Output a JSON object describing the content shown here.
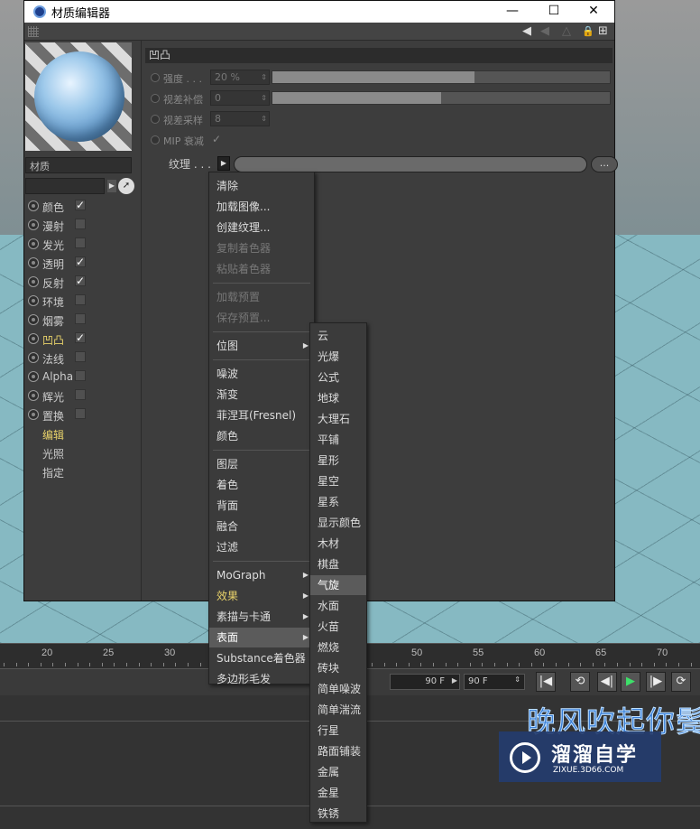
{
  "window": {
    "title": "材质编辑器",
    "buttons": {
      "minimize": "—",
      "maximize": "☐",
      "close": "✕"
    }
  },
  "toolbar": {
    "icons": [
      "grip-icon",
      "arrow-back-icon",
      "triangle-icon",
      "lock-icon",
      "add-panel-icon"
    ],
    "lock_glyph": "🔒",
    "add_glyph": "⊞"
  },
  "left": {
    "material_name": "材质",
    "channels": [
      {
        "label": "颜色",
        "checked": true
      },
      {
        "label": "漫射",
        "checked": false
      },
      {
        "label": "发光",
        "checked": false
      },
      {
        "label": "透明",
        "checked": true
      },
      {
        "label": "反射",
        "checked": true
      },
      {
        "label": "环境",
        "checked": false
      },
      {
        "label": "烟雾",
        "checked": false
      },
      {
        "label": "凹凸",
        "checked": true,
        "active": true
      },
      {
        "label": "法线",
        "checked": false
      },
      {
        "label": "Alpha",
        "checked": false
      },
      {
        "label": "辉光",
        "checked": false
      },
      {
        "label": "置换",
        "checked": false
      }
    ],
    "subtabs": [
      {
        "label": "编辑",
        "active": true
      },
      {
        "label": "光照"
      },
      {
        "label": "指定"
      }
    ]
  },
  "right": {
    "section_title": "凹凸",
    "params": [
      {
        "label": "强度 . . .",
        "value": "20 %",
        "fill": 0.6
      },
      {
        "label": "视差补偿",
        "value": "0",
        "fill": 0.5
      },
      {
        "label": "视差采样",
        "value": "8"
      },
      {
        "label": "MIP 衰减",
        "check": "✓"
      }
    ],
    "texture_label": "纹理 . . .",
    "texture_more": "..."
  },
  "context_menu": {
    "items": [
      {
        "label": "清除"
      },
      {
        "label": "加载图像..."
      },
      {
        "label": "创建纹理..."
      },
      {
        "label": "复制着色器",
        "disabled": true
      },
      {
        "label": "粘贴着色器",
        "disabled": true
      },
      {
        "sep": true
      },
      {
        "label": "加载预置",
        "disabled": true
      },
      {
        "label": "保存预置...",
        "disabled": true
      },
      {
        "sep": true
      },
      {
        "label": "位图",
        "submenu": true
      },
      {
        "sep": true
      },
      {
        "label": "噪波"
      },
      {
        "label": "渐变"
      },
      {
        "label": "菲涅耳(Fresnel)"
      },
      {
        "label": "颜色"
      },
      {
        "sep": true
      },
      {
        "label": "图层"
      },
      {
        "label": "着色"
      },
      {
        "label": "背面"
      },
      {
        "label": "融合"
      },
      {
        "label": "过滤"
      },
      {
        "sep": true
      },
      {
        "label": "MoGraph",
        "submenu": true
      },
      {
        "label": "效果",
        "submenu": true,
        "yellow": true
      },
      {
        "label": "素描与卡通",
        "submenu": true
      },
      {
        "label": "表面",
        "submenu": true,
        "highlighted": true
      },
      {
        "label": "Substance着色器"
      },
      {
        "label": "多边形毛发"
      }
    ]
  },
  "surface_submenu": {
    "items": [
      "云",
      "光爆",
      "公式",
      "地球",
      "大理石",
      "平铺",
      "星形",
      "星空",
      "星系",
      "显示颜色",
      "木材",
      "棋盘",
      "气旋",
      "水面",
      "火苗",
      "燃烧",
      "砖块",
      "简单噪波",
      "简单湍流",
      "行星",
      "路面铺装",
      "金属",
      "金星",
      "铁锈"
    ],
    "highlighted": "气旋"
  },
  "timeline": {
    "ticks": [
      "20",
      "25",
      "30",
      "50",
      "55",
      "60",
      "65",
      "70"
    ],
    "end_frame": "90 F",
    "end_frame2": "90 F"
  },
  "transport": {
    "icons": [
      "goto-start-icon",
      "loop-icon",
      "step-back-icon",
      "play-icon",
      "step-forward-icon",
      "record-icon"
    ],
    "glyphs": [
      "|◀",
      "⟲",
      "◀|",
      "▶",
      "|▶",
      "⟳"
    ]
  },
  "watermark": {
    "caption": "晚风吹起你鬓",
    "brand": "溜溜自学",
    "site": "ZIXUE.3D66.COM"
  }
}
